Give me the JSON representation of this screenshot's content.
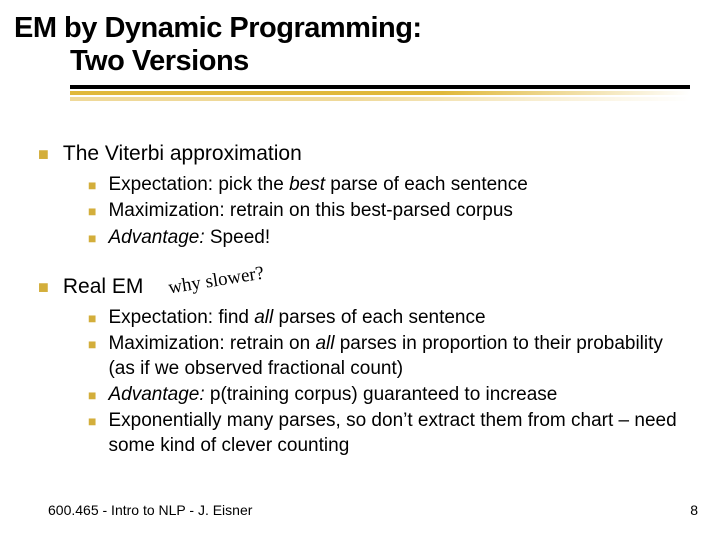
{
  "title_line1": "EM by Dynamic Programming:",
  "title_line2": "Two Versions",
  "sec1": {
    "heading": "The Viterbi approximation",
    "b1_a": "Expectation: pick the ",
    "b1_b": "best",
    "b1_c": " parse of each sentence",
    "b2": "Maximization: retrain on this best-parsed corpus",
    "b3_a": "Advantage:",
    "b3_b": " Speed!"
  },
  "sec2": {
    "heading": "Real EM",
    "annot": "why slower?",
    "b1_a": "Expectation: find ",
    "b1_b": "all",
    "b1_c": " parses of each sentence",
    "b2_a": "Maximization: retrain on ",
    "b2_b": "all",
    "b2_c": " parses in proportion to their probability (as if we observed fractional count)",
    "b3_a": "Advantage:",
    "b3_b": " p(training corpus) guaranteed to increase",
    "b4": "Exponentially many parses, so don’t extract them from chart – need some kind of clever counting"
  },
  "footer_left": "600.465 - Intro to NLP - J. Eisner",
  "footer_right": "8"
}
